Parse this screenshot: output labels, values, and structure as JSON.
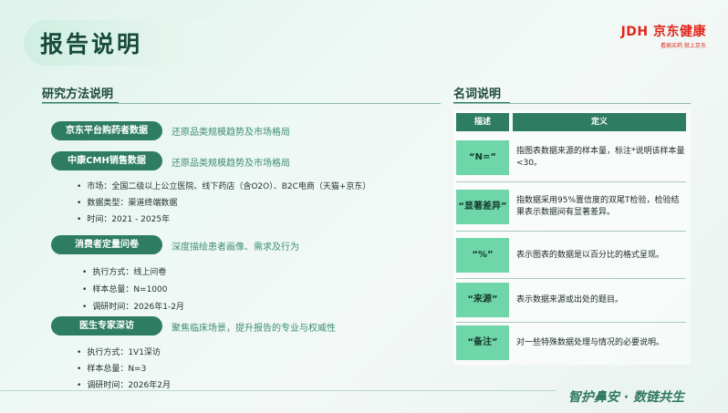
{
  "header": {
    "title": "报告说明",
    "logo_main": "JDH 京东健康",
    "logo_sub": "看病买药 就上京东"
  },
  "left": {
    "section_title": "研究方法说明",
    "blocks": [
      {
        "label": "京东平台购药者数据",
        "desc": "还原品类规模趋势及市场格局",
        "bullets": []
      },
      {
        "label": "中康CMH销售数据",
        "desc": "还原品类规模趋势及市场格局",
        "bullets": [
          "市场：全国二级以上公立医院、线下药店（含O2O）、B2C电商（天猫+京东）",
          "数据类型：渠道终端数据",
          "时间：2021 - 2025年"
        ]
      },
      {
        "label": "消费者定量问卷",
        "desc": "深度描绘患者画像、需求及行为",
        "bullets": [
          "执行方式：线上问卷",
          "样本总量：N=1000",
          "调研时间：2026年1-2月"
        ]
      },
      {
        "label": "医生专家深访",
        "desc": "聚焦临床场景，提升报告的专业与权威性",
        "bullets": [
          "执行方式：1V1深访",
          "样本总量：N=3",
          "调研时间：2026年2月"
        ]
      }
    ]
  },
  "right": {
    "section_title": "名词说明",
    "col_term": "描述",
    "col_def": "定义",
    "rows": [
      {
        "term": "“N=”",
        "def": "指图表数据来源的样本量，标注*说明该样本量<30。"
      },
      {
        "term": "“显著差异”",
        "def": "指数据采用95%置信度的双尾T检验，检验结果表示数据间有显著差异。"
      },
      {
        "term": "“%”",
        "def": "表示图表的数据是以百分比的格式呈现。"
      },
      {
        "term": "“来源”",
        "def": "表示数据来源或出处的题目。"
      },
      {
        "term": "“备注”",
        "def": "对一些特殊数据处理与情况的必要说明。"
      }
    ]
  },
  "footer": {
    "slogan": "智护鼻安 · 数链共生"
  }
}
